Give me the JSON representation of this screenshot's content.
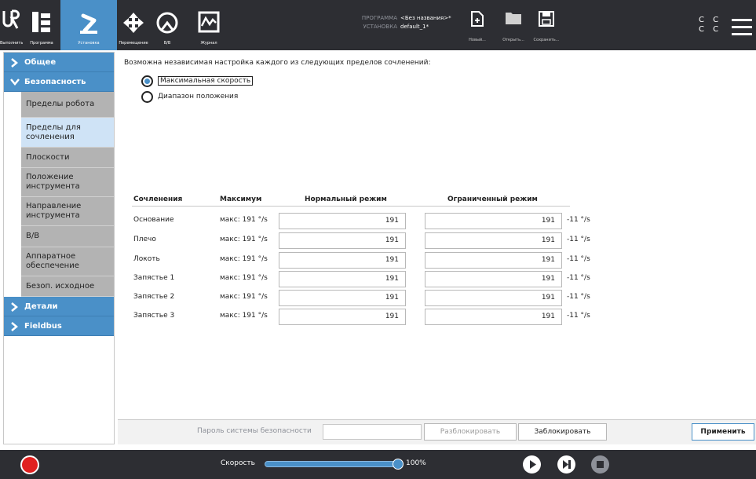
{
  "toolbar": {
    "buttons": [
      {
        "label": "Выполнить"
      },
      {
        "label": "Программа"
      },
      {
        "label": "Установка"
      },
      {
        "label": "Перемещение"
      },
      {
        "label": "В/В"
      },
      {
        "label": "Журнал"
      }
    ],
    "program_key": "ПРОГРАММА",
    "program_value": "<Без названия>*",
    "installation_key": "УСТАНОВКА",
    "installation_value": "default_1*",
    "file": {
      "new_label": "Новый...",
      "open_label": "Открыть...",
      "save_label": "Сохранить..."
    },
    "cc_text": "C C",
    "cc_text2": "C C"
  },
  "sidebar": {
    "general": "Общее",
    "safety": "Безопасность",
    "items": [
      {
        "label": "Пределы робота"
      },
      {
        "label": "Пределы для сочленения"
      },
      {
        "label": "Плоскости"
      },
      {
        "label": "Положение инструмента"
      },
      {
        "label": "Направление инструмента"
      },
      {
        "label": "В/В"
      },
      {
        "label": "Аппаратное обеспечение"
      },
      {
        "label": "Безоп. исходное"
      }
    ],
    "details": "Детали",
    "fieldbus": "Fieldbus"
  },
  "main": {
    "intro": "Возможна независимая настройка каждого из следующих пределов сочленений:",
    "radio_speed": "Максимальная скорость",
    "radio_range": "Диапазон положения",
    "headers": {
      "joint": "Сочленения",
      "max": "Максимум",
      "normal": "Нормальный режим",
      "reduced": "Ограниченный режим"
    },
    "rows": [
      {
        "joint": "Основание",
        "max": "макс: 191 °/s",
        "normal": "191",
        "reduced": "191",
        "delta": "-11 °/s"
      },
      {
        "joint": "Плечо",
        "max": "макс: 191 °/s",
        "normal": "191",
        "reduced": "191",
        "delta": "-11 °/s"
      },
      {
        "joint": "Локоть",
        "max": "макс: 191 °/s",
        "normal": "191",
        "reduced": "191",
        "delta": "-11 °/s"
      },
      {
        "joint": "Запястье 1",
        "max": "макс: 191 °/s",
        "normal": "191",
        "reduced": "191",
        "delta": "-11 °/s"
      },
      {
        "joint": "Запястье 2",
        "max": "макс: 191 °/s",
        "normal": "191",
        "reduced": "191",
        "delta": "-11 °/s"
      },
      {
        "joint": "Запястье 3",
        "max": "макс: 191 °/s",
        "normal": "191",
        "reduced": "191",
        "delta": "-11 °/s"
      }
    ]
  },
  "footer": {
    "password_label": "Пароль системы безопасности",
    "unlock": "Разблокировать",
    "lock": "Заблокировать",
    "apply": "Применить"
  },
  "status": {
    "speed_label": "Скорость",
    "speed_value": "100%",
    "speed_fraction": 1.0
  },
  "colors": {
    "accent": "#4a90c8",
    "topbar": "#2d2e33",
    "record": "#e02020"
  }
}
